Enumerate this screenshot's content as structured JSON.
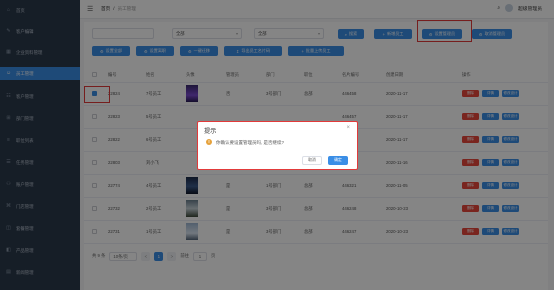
{
  "sidebar": {
    "items": [
      {
        "label": "首页",
        "icon": "home-icon"
      },
      {
        "label": "客户编辑",
        "icon": "edit-icon"
      },
      {
        "label": "企业资料管理",
        "icon": "building-icon"
      },
      {
        "label": "员工管理",
        "icon": "user-icon"
      },
      {
        "label": "客户管理",
        "icon": "contacts-icon"
      },
      {
        "label": "部门管理",
        "icon": "org-icon"
      },
      {
        "label": "职位列表",
        "icon": "list-icon"
      },
      {
        "label": "任务管理",
        "icon": "task-icon"
      },
      {
        "label": "账户管理",
        "icon": "account-icon"
      },
      {
        "label": "门店管理",
        "icon": "store-icon"
      },
      {
        "label": "套餐管理",
        "icon": "package-icon"
      },
      {
        "label": "产品管理",
        "icon": "product-icon"
      },
      {
        "label": "新闻管理",
        "icon": "news-icon"
      }
    ]
  },
  "topbar": {
    "breadcrumb": [
      "首页",
      "/",
      "员工管理"
    ],
    "user_name": "超级管理员"
  },
  "filters": {
    "name_placeholder": "",
    "select1": "全部",
    "select2": "全部"
  },
  "toolbar": {
    "search": "搜索",
    "add": "新增员工",
    "set_admin": "设置管理员",
    "cancel_admin": "取消管理员",
    "set_all": "设置全部",
    "set_clear": "设置离职",
    "one_key": "一键迁移",
    "export": "导出员工名片码",
    "batch_upload": "批量上传员工"
  },
  "table": {
    "headers": [
      "",
      "编号",
      "姓名",
      "头像",
      "管理员",
      "部门",
      "职位",
      "名片编号",
      "创建日期",
      "操作"
    ],
    "rows": [
      {
        "id": "22824",
        "name": "7号员工",
        "thumb": "purple",
        "admin": "否",
        "dept": "3号部门",
        "pos": "总部",
        "card": "446458",
        "date": "2020-11-17",
        "checked": true
      },
      {
        "id": "22823",
        "name": "5号员工",
        "thumb": "",
        "admin": "",
        "dept": "",
        "pos": "",
        "card": "446457",
        "date": "2020-11-17",
        "checked": false
      },
      {
        "id": "22822",
        "name": "6号员工",
        "thumb": "",
        "admin": "",
        "dept": "3号部门",
        "pos": "",
        "card": "446456",
        "date": "2020-11-17",
        "checked": false
      },
      {
        "id": "22803",
        "name": "刘小飞",
        "thumb": "",
        "admin": "是",
        "dept": "1号部门",
        "pos": "总部",
        "card": "446418",
        "date": "2020-11-16",
        "checked": false
      },
      {
        "id": "22774",
        "name": "4号员工",
        "thumb": "night",
        "admin": "是",
        "dept": "1号部门",
        "pos": "总部",
        "card": "446321",
        "date": "2020-11-05",
        "checked": false
      },
      {
        "id": "22732",
        "name": "2号员工",
        "thumb": "tree",
        "admin": "是",
        "dept": "3号部门",
        "pos": "总部",
        "card": "446248",
        "date": "2020-10-23",
        "checked": false
      },
      {
        "id": "22731",
        "name": "1号员工",
        "thumb": "bird",
        "admin": "是",
        "dept": "3号部门",
        "pos": "总部",
        "card": "446247",
        "date": "2020-10-23",
        "checked": false
      }
    ],
    "actions": [
      "删除",
      "详情",
      "修改设计"
    ]
  },
  "pager": {
    "total": "共 9 条",
    "page_size": "10条/页",
    "prev": "<",
    "page": "1",
    "next": ">",
    "goto": "前往",
    "goto_value": "1",
    "page_unit": "页"
  },
  "dialog": {
    "title": "提示",
    "message": "你确认要设置管理员吗, 是否继续?",
    "cancel": "取消",
    "ok": "确定"
  },
  "colors": {
    "accent": "#3a8ee6",
    "danger": "#e8483c",
    "sidebar": "#2b3a4c",
    "highlight": "#e23a3a"
  }
}
